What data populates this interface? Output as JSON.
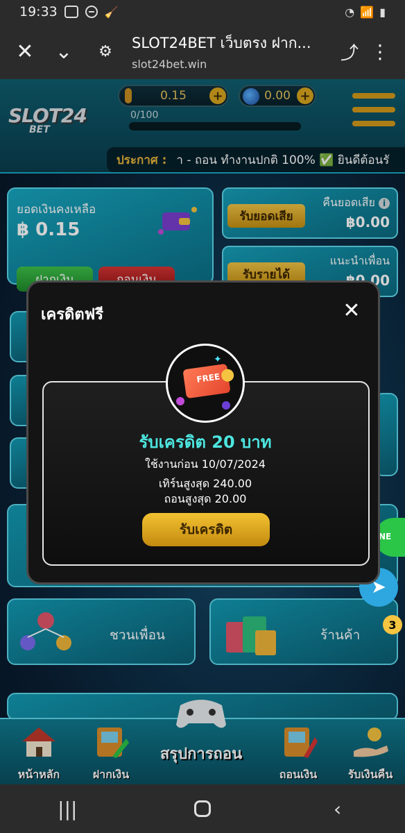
{
  "status_bar": {
    "time": "19:33",
    "signal": "📶"
  },
  "browser": {
    "title": "SLOT24BET เว็บตรง ฝาก...",
    "url": "slot24bet.win"
  },
  "header": {
    "logo_main": "SLOT24",
    "logo_sub": "BET",
    "credit_value": "0.15",
    "points_value": "0.00",
    "progress_label": "0/100",
    "progress_fraction": 0
  },
  "announcement": {
    "label": "ประกาศ :",
    "text": "า - ถอน ทำงานปกติ 100% ✅ ยินดีต้อนรั"
  },
  "balance": {
    "label": "ยอดเงินคงเหลือ",
    "amount": "฿ 0.15",
    "deposit_label": "ฝากเงิน",
    "withdraw_label": "ถอนเงิน"
  },
  "cashback": {
    "button": "รับยอดเสีย",
    "title": "คืนยอดเสีย",
    "value": "฿0.00"
  },
  "referral": {
    "button": "รับรายได้",
    "title": "แนะนำเพื่อน",
    "value": "฿0.00"
  },
  "promo": {
    "invite_label": "ชวนเพื่อน",
    "shop_label": "ร้านค้า"
  },
  "bottom_nav": {
    "home": "หน้าหลัก",
    "deposit": "ฝากเงิน",
    "center": "สรุปการถอน",
    "withdraw": "ถอนเงิน",
    "cashback": "รับเงินคืน"
  },
  "modal": {
    "title": "เครดิตฟรี",
    "badge_text": "FREE",
    "credit_title": "รับเครดิต 20 บาท",
    "use_before": "ใช้งานก่อน 10/07/2024",
    "max_turn": "เทิร์นสูงสุด 240.00",
    "max_withdraw": "ถอนสูงสุด 20.00",
    "claim_label": "รับเครดิต"
  },
  "floating": {
    "line_label": "NE",
    "badge_count": "3"
  },
  "colors": {
    "accent_gold": "#f2c232",
    "teal": "#4de6e0",
    "panel": "#141414"
  }
}
